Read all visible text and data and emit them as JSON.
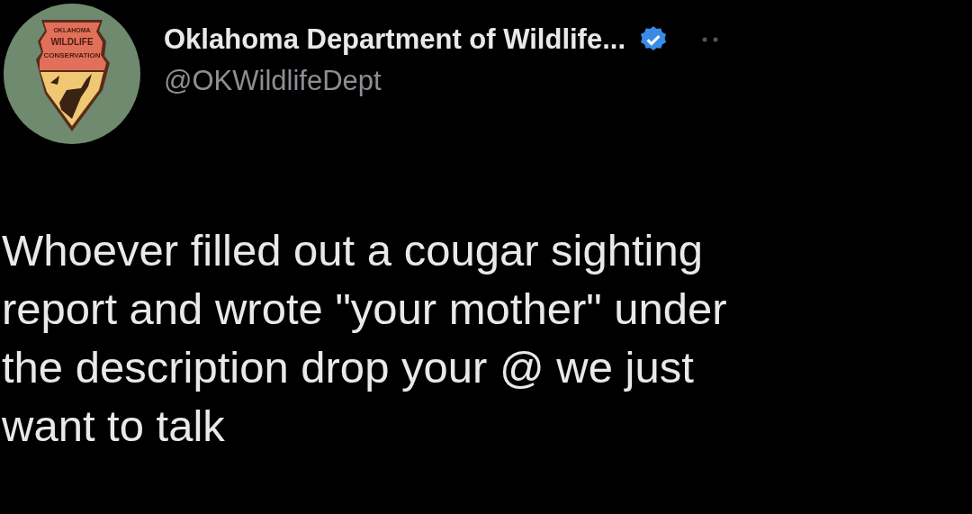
{
  "author": {
    "avatar": {
      "logo_lines": [
        "OKLAHOMA",
        "WILDLIFE",
        "CONSERVATION"
      ]
    },
    "name": "Oklahoma Department of Wildlife...",
    "verified": true,
    "handle": "@OKWildlifeDept"
  },
  "tweet": {
    "text": "Whoever filled out a cougar sighting\nreport and wrote \"your mother\" under\nthe description drop your @ we just\nwant to talk"
  }
}
